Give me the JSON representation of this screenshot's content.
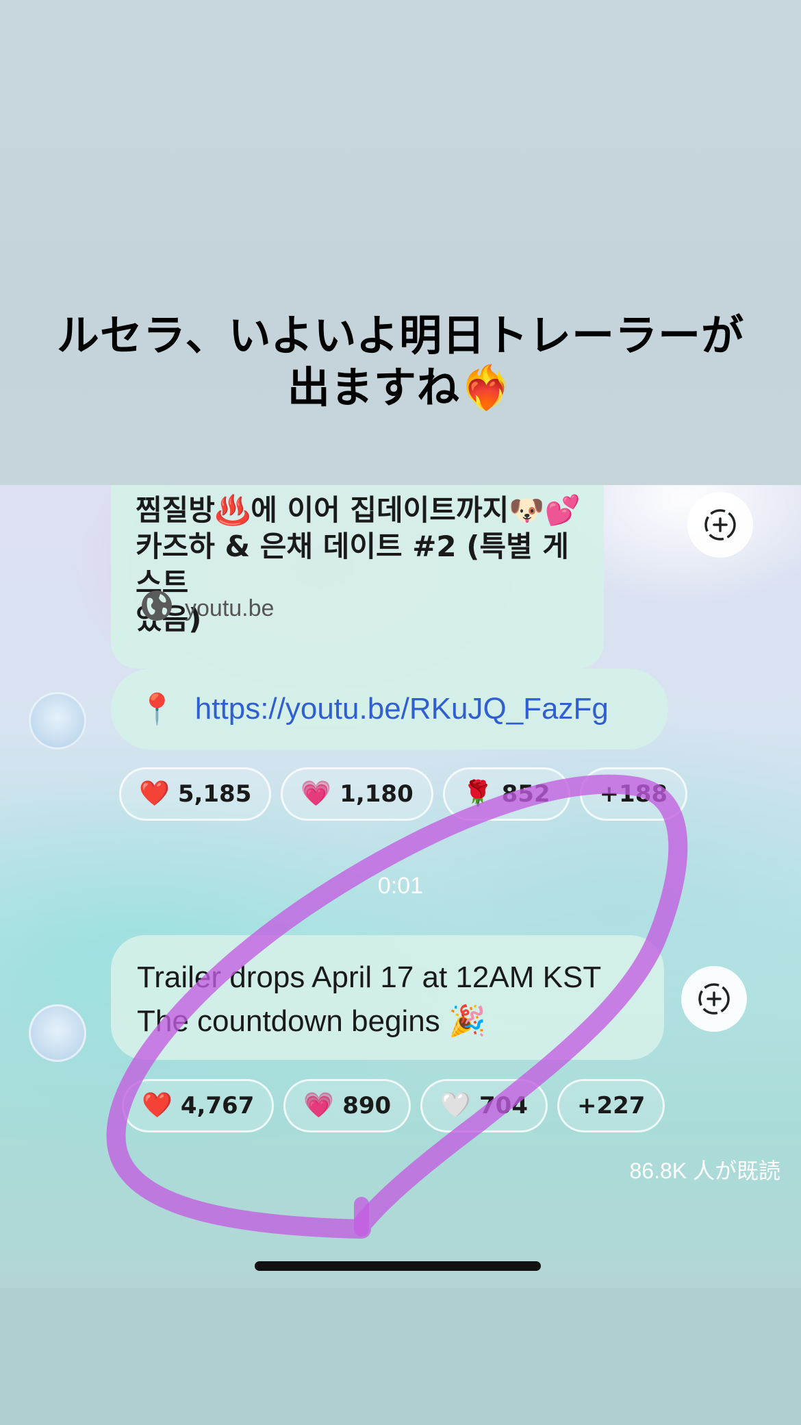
{
  "headline": {
    "line1": "ルセラ、いよいよ明日トレーラーが",
    "line2": "出ますね❤️‍🔥"
  },
  "link_preview": {
    "title_line1": "찜질방♨️에 이어 집데이트까지🐶💕",
    "title_line2": "카즈하 & 은채 데이트 #2 (특별 게스트",
    "title_line3": "있음)",
    "domain": "youtu.be",
    "domain_icon": "globe-icon"
  },
  "url_message": {
    "pin_emoji": "📍",
    "url": "https://youtu.be/RKuJQ_FazFg"
  },
  "reactions_1": [
    {
      "emoji": "❤️",
      "count": "5,185"
    },
    {
      "emoji": "💗",
      "count": "1,180"
    },
    {
      "emoji": "🌹",
      "count": "852"
    },
    {
      "emoji": "",
      "count": "+188"
    }
  ],
  "timestamp": "0:01",
  "message": {
    "line1": "Trailer drops April 17 at 12AM KST",
    "line2": "The countdown begins 🎉"
  },
  "reactions_2": [
    {
      "emoji": "❤️",
      "count": "4,767"
    },
    {
      "emoji": "💗",
      "count": "890"
    },
    {
      "emoji": "🤍",
      "count": "704"
    },
    {
      "emoji": "",
      "count": "+227"
    }
  ],
  "read_count": "86.8K 人が既読",
  "colors": {
    "link": "#2f5fd0",
    "scribble": "#c35ee0",
    "bubble": "#d4f0e8"
  }
}
